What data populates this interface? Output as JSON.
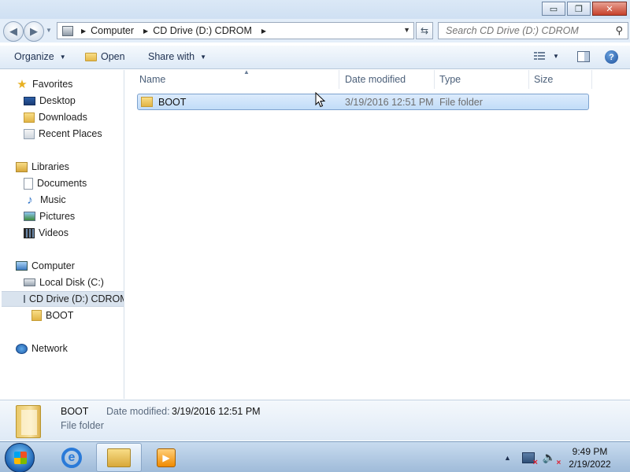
{
  "window": {
    "controls": {
      "minimize": "▭",
      "maximize": "❐",
      "close": "✕"
    }
  },
  "address": {
    "breadcrumbs": [
      "Computer",
      "CD Drive (D:) CDROM"
    ],
    "search_placeholder": "Search CD Drive (D:) CDROM"
  },
  "toolbar": {
    "organize": "Organize",
    "open": "Open",
    "share_with": "Share with"
  },
  "nav": {
    "favorites": {
      "label": "Favorites",
      "items": [
        "Desktop",
        "Downloads",
        "Recent Places"
      ]
    },
    "libraries": {
      "label": "Libraries",
      "items": [
        "Documents",
        "Music",
        "Pictures",
        "Videos"
      ]
    },
    "computer": {
      "label": "Computer",
      "items": [
        "Local Disk (C:)",
        "CD Drive (D:) CDROM"
      ],
      "subfolder": "BOOT"
    },
    "network": "Network"
  },
  "columns": [
    "Name",
    "Date modified",
    "Type",
    "Size"
  ],
  "files": [
    {
      "name": "BOOT",
      "date_modified": "3/19/2016 12:51 PM",
      "type": "File folder",
      "size": ""
    }
  ],
  "details": {
    "name": "BOOT",
    "date_label": "Date modified:",
    "date_value": "3/19/2016 12:51 PM",
    "type": "File folder"
  },
  "taskbar": {
    "time": "9:49 PM",
    "date": "2/19/2022"
  },
  "colors": {
    "selection": "#c1dcf8",
    "selection_border": "#7da2ce",
    "taskbar": "#9fbbd9"
  },
  "icons": [
    "back-icon",
    "forward-icon",
    "refresh-icon",
    "search-icon",
    "folder-icon",
    "star-icon",
    "help-icon"
  ]
}
